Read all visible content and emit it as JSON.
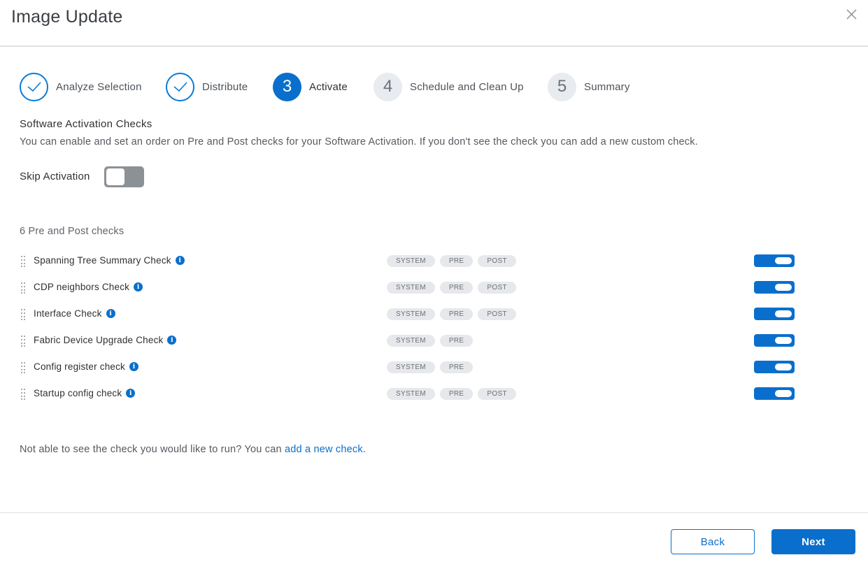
{
  "header": {
    "title": "Image Update"
  },
  "stepper": {
    "steps": [
      {
        "number": "1",
        "label": "Analyze Selection",
        "state": "done"
      },
      {
        "number": "2",
        "label": "Distribute",
        "state": "done"
      },
      {
        "number": "3",
        "label": "Activate",
        "state": "active"
      },
      {
        "number": "4",
        "label": "Schedule and Clean Up",
        "state": "future"
      },
      {
        "number": "5",
        "label": "Summary",
        "state": "future"
      }
    ]
  },
  "section": {
    "title": "Software Activation Checks",
    "description": "You can enable and set an order on Pre and Post checks for your Software Activation. If you don't see the check you can add a new custom check."
  },
  "skip_activation": {
    "label": "Skip Activation",
    "enabled": false
  },
  "checks": {
    "count_label": "6 Pre and Post checks",
    "items": [
      {
        "name": "Spanning Tree Summary Check",
        "tags": [
          "SYSTEM",
          "PRE",
          "POST"
        ],
        "enabled": true
      },
      {
        "name": "CDP neighbors Check",
        "tags": [
          "SYSTEM",
          "PRE",
          "POST"
        ],
        "enabled": true
      },
      {
        "name": "Interface Check",
        "tags": [
          "SYSTEM",
          "PRE",
          "POST"
        ],
        "enabled": true
      },
      {
        "name": "Fabric Device Upgrade Check",
        "tags": [
          "SYSTEM",
          "PRE"
        ],
        "enabled": true
      },
      {
        "name": "Config register check",
        "tags": [
          "SYSTEM",
          "PRE"
        ],
        "enabled": true
      },
      {
        "name": "Startup config check",
        "tags": [
          "SYSTEM",
          "PRE",
          "POST"
        ],
        "enabled": true
      }
    ]
  },
  "footer_note": {
    "text": "Not able to see the check you would like to run? You can ",
    "link": "add a new check",
    "suffix": "."
  },
  "buttons": {
    "back": "Back",
    "next": "Next"
  },
  "colors": {
    "accent": "#0a6fcc",
    "toggle_off": "#8c9196",
    "tag_bg": "#e6e8eb"
  },
  "icons": {
    "close": "close-icon",
    "check": "checkmark-icon",
    "info": "info-icon",
    "drag": "drag-handle-icon"
  }
}
